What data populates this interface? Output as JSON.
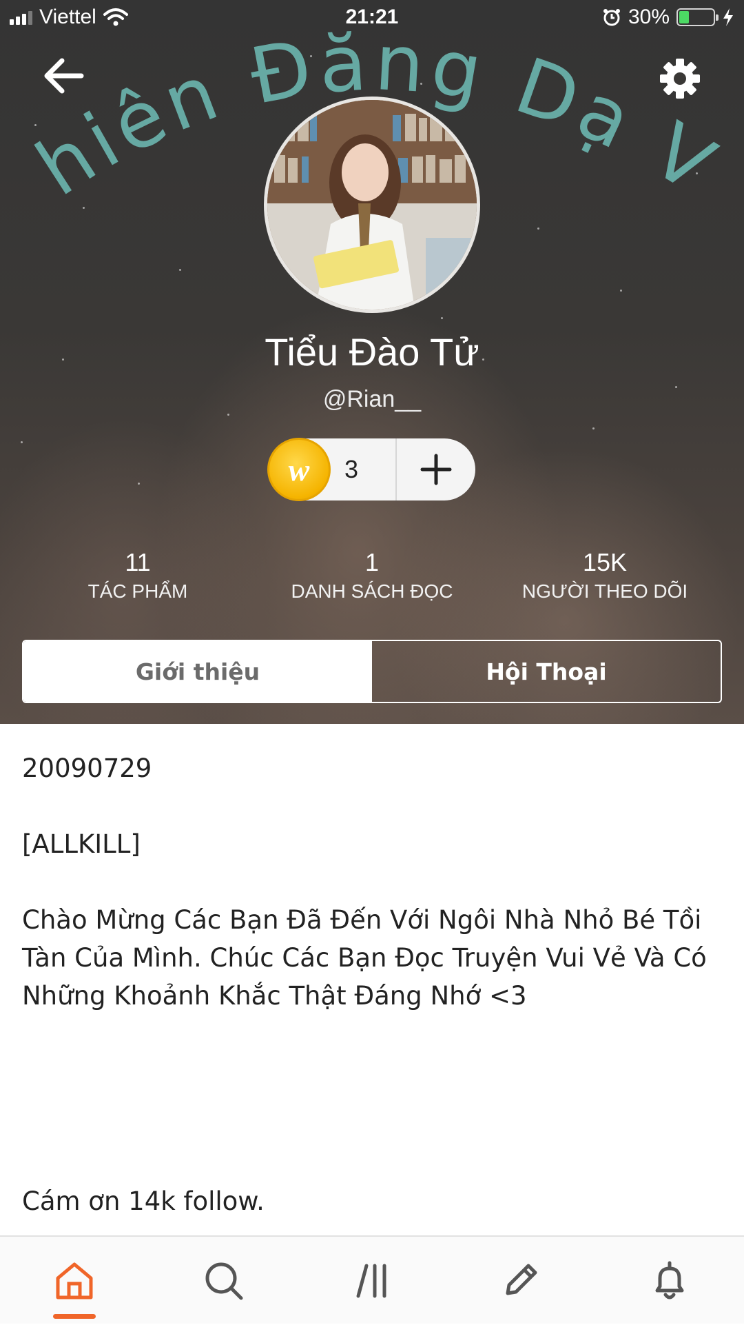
{
  "status_bar": {
    "carrier": "Viettel",
    "time": "21:21",
    "battery_percent": "30%",
    "battery_level": 0.3
  },
  "banner": {
    "title_text": "Thiên Đăng Dạ Vũ",
    "title_color": "#6ab3ad"
  },
  "profile": {
    "display_name": "Tiểu Đào Tử",
    "username": "@Rian__",
    "coins": "3",
    "coin_icon_letter": "w"
  },
  "stats": [
    {
      "value": "11",
      "label": "TÁC PHẨM"
    },
    {
      "value": "1",
      "label": "DANH SÁCH ĐỌC"
    },
    {
      "value": "15K",
      "label": "NGƯỜI THEO DÕI"
    }
  ],
  "tabs": {
    "about": "Giới thiệu",
    "conversation": "Hội Thoại",
    "active": "about"
  },
  "about": {
    "line1": "20090729",
    "line2": "[ALLKILL]",
    "line3": "Chào Mừng Các Bạn Đã Đến Với Ngôi Nhà Nhỏ Bé Tồi Tàn Của Mình. Chúc Các Bạn Đọc Truyện Vui Vẻ Và Có Những Khoảnh Khắc Thật Đáng Nhớ <3",
    "line4": "Cám ơn 14k follow."
  },
  "bottom_nav": {
    "items": [
      "home-icon",
      "search-icon",
      "library-icon",
      "write-icon",
      "notifications-icon"
    ],
    "active": "home-icon",
    "active_color": "#f06529",
    "inactive_color": "#555555"
  }
}
